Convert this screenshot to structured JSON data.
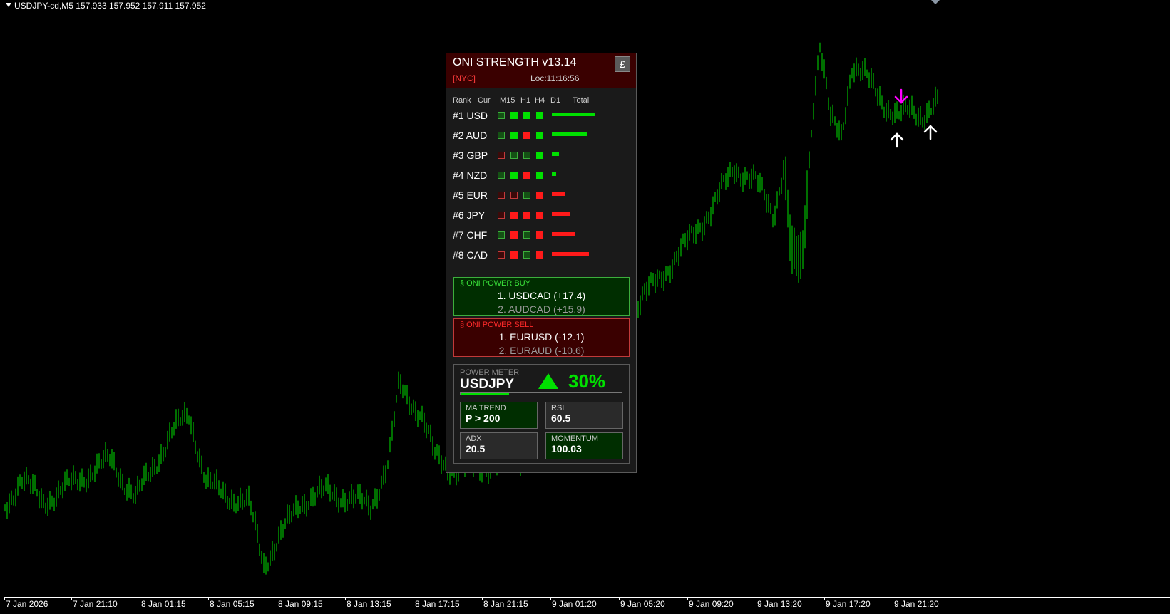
{
  "symbol_header": "USDJPY-cd,M5  157.933 157.952 157.911 157.952",
  "time_axis": [
    "7 Jan 2026",
    "7 Jan 21:10",
    "8 Jan 01:15",
    "8 Jan 05:15",
    "8 Jan 09:15",
    "8 Jan 13:15",
    "8 Jan 17:15",
    "8 Jan 21:15",
    "9 Jan 01:20",
    "9 Jan 05:20",
    "9 Jan 09:20",
    "9 Jan 13:20",
    "9 Jan 17:20",
    "9 Jan 21:20"
  ],
  "colors": {
    "bar": "#00e000",
    "bear_arrow": "#ff00ff",
    "bull_arrow": "#ffffff",
    "price_line": "#7f95a8"
  },
  "signal_icons": {
    "down": "magenta-down-arrow-icon",
    "up": "white-up-arrow-icon"
  },
  "panel": {
    "title": "ONI STRENGTH v13.14",
    "currency_button": "£",
    "session": "[NYC]",
    "local_time": "Loc:11:16:56",
    "columns": {
      "rank": "Rank",
      "cur": "Cur",
      "m15": "M15",
      "h1": "H1",
      "h4": "H4",
      "d1": "D1",
      "total": "Total"
    },
    "rows": [
      {
        "label": "#1 USD",
        "cells": [
          "g",
          "G",
          "G",
          "G"
        ],
        "total_color": "#00e000",
        "total_strength": 1.0
      },
      {
        "label": "#2 AUD",
        "cells": [
          "g",
          "G",
          "R",
          "G"
        ],
        "total_color": "#00e000",
        "total_strength": 0.83
      },
      {
        "label": "#3 GBP",
        "cells": [
          "r",
          "g",
          "g",
          "G"
        ],
        "total_color": "#00e000",
        "total_strength": 0.17
      },
      {
        "label": "#4 NZD",
        "cells": [
          "g",
          "G",
          "R",
          "G"
        ],
        "total_color": "#00e000",
        "total_strength": 0.1
      },
      {
        "label": "#5 EUR",
        "cells": [
          "r",
          "r",
          "g",
          "R"
        ],
        "total_color": "#ff1a1a",
        "total_strength": 0.31
      },
      {
        "label": "#6 JPY",
        "cells": [
          "r",
          "R",
          "R",
          "R"
        ],
        "total_color": "#ff1a1a",
        "total_strength": 0.41
      },
      {
        "label": "#7 CHF",
        "cells": [
          "g",
          "R",
          "g",
          "R"
        ],
        "total_color": "#ff1a1a",
        "total_strength": 0.53
      },
      {
        "label": "#8 CAD",
        "cells": [
          "r",
          "R",
          "g",
          "R"
        ],
        "total_color": "#ff1a1a",
        "total_strength": 0.86
      }
    ],
    "power_buy": {
      "title": "§ ONI POWER BUY",
      "items": [
        "1. USDCAD (+17.4)",
        "2. AUDCAD (+15.9)"
      ]
    },
    "power_sell": {
      "title": "§ ONI POWER SELL",
      "items": [
        "1. EURUSD (-12.1)",
        "2. EURAUD (-10.6)"
      ]
    },
    "power_meter": {
      "label": "POWER METER",
      "symbol": "USDJPY",
      "direction_icon": "green-up-triangle-icon",
      "percent": "30%",
      "fill_fraction": 0.3,
      "indicators": [
        {
          "label": "MA TREND",
          "value": "P > 200",
          "tone": "green"
        },
        {
          "label": "RSI",
          "value": "60.5",
          "tone": "dark"
        },
        {
          "label": "ADX",
          "value": "20.5",
          "tone": "dark"
        },
        {
          "label": "MOMENTUM",
          "value": "100.03",
          "tone": "green"
        }
      ]
    }
  }
}
